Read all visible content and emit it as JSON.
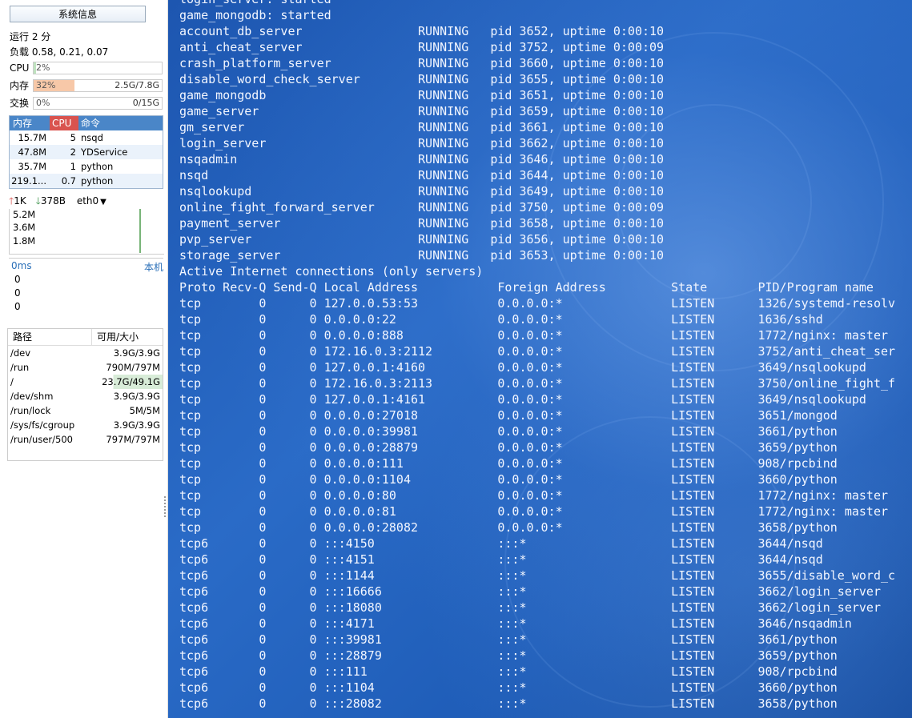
{
  "sidebar": {
    "title": "系统信息",
    "uptime": "运行 2 分",
    "load": "负载 0.58, 0.21, 0.07",
    "meters": {
      "cpu": {
        "label": "CPU",
        "percent": "2%",
        "value": "",
        "fill": 0.02,
        "color": "#bfe3bf"
      },
      "mem": {
        "label": "内存",
        "percent": "32%",
        "value": "2.5G/7.8G",
        "fill": 0.32,
        "color": "#f7c8a8"
      },
      "swap": {
        "label": "交换",
        "percent": "0%",
        "value": "0/15G",
        "fill": 0.0,
        "color": "#cfe0f5"
      }
    },
    "process_table": {
      "headers": {
        "mem": "内存",
        "cpu": "CPU",
        "cmd": "命令"
      },
      "rows": [
        {
          "mem": "15.7M",
          "cpu": "5",
          "cmd": "nsqd"
        },
        {
          "mem": "47.8M",
          "cpu": "2",
          "cmd": "YDService"
        },
        {
          "mem": "35.7M",
          "cpu": "1",
          "cmd": "python"
        },
        {
          "mem": "219.1...",
          "cpu": "0.7",
          "cmd": "python"
        }
      ]
    },
    "network": {
      "up_arrow": "🡑",
      "up": "1K",
      "down_arrow": "🡓",
      "down": "378B",
      "iface": "eth0",
      "dropdown": "▼",
      "ticks": [
        "5.2M",
        "3.6M",
        "1.8M"
      ]
    },
    "ping": {
      "latency": "0ms",
      "host": "本机",
      "values": [
        "0",
        "0",
        "0"
      ]
    },
    "disk": {
      "headers": {
        "path": "路径",
        "size": "可用/大小"
      },
      "rows": [
        {
          "path": "/dev",
          "size": "3.9G/3.9G"
        },
        {
          "path": "/run",
          "size": "790M/797M"
        },
        {
          "path": "/",
          "size": "23.7G/49.1G"
        },
        {
          "path": "/dev/shm",
          "size": "3.9G/3.9G"
        },
        {
          "path": "/run/lock",
          "size": "5M/5M"
        },
        {
          "path": "/sys/fs/cgroup",
          "size": "3.9G/3.9G"
        },
        {
          "path": "/run/user/500",
          "size": "797M/797M"
        }
      ]
    }
  },
  "terminal": {
    "lines": [
      "login_server: started",
      "game_mongodb: started",
      "account_db_server                RUNNING   pid 3652, uptime 0:00:10",
      "anti_cheat_server                RUNNING   pid 3752, uptime 0:00:09",
      "crash_platform_server            RUNNING   pid 3660, uptime 0:00:10",
      "disable_word_check_server        RUNNING   pid 3655, uptime 0:00:10",
      "game_mongodb                     RUNNING   pid 3651, uptime 0:00:10",
      "game_server                      RUNNING   pid 3659, uptime 0:00:10",
      "gm_server                        RUNNING   pid 3661, uptime 0:00:10",
      "login_server                     RUNNING   pid 3662, uptime 0:00:10",
      "nsqadmin                         RUNNING   pid 3646, uptime 0:00:10",
      "nsqd                             RUNNING   pid 3644, uptime 0:00:10",
      "nsqlookupd                       RUNNING   pid 3649, uptime 0:00:10",
      "online_fight_forward_server      RUNNING   pid 3750, uptime 0:00:09",
      "payment_server                   RUNNING   pid 3658, uptime 0:00:10",
      "pvp_server                       RUNNING   pid 3656, uptime 0:00:10",
      "storage_server                   RUNNING   pid 3653, uptime 0:00:10",
      "Active Internet connections (only servers)",
      "Proto Recv-Q Send-Q Local Address           Foreign Address         State       PID/Program name",
      "tcp        0      0 127.0.0.53:53           0.0.0.0:*               LISTEN      1326/systemd-resolv",
      "tcp        0      0 0.0.0.0:22              0.0.0.0:*               LISTEN      1636/sshd",
      "tcp        0      0 0.0.0.0:888             0.0.0.0:*               LISTEN      1772/nginx: master",
      "tcp        0      0 172.16.0.3:2112         0.0.0.0:*               LISTEN      3752/anti_cheat_ser",
      "tcp        0      0 127.0.0.1:4160          0.0.0.0:*               LISTEN      3649/nsqlookupd",
      "tcp        0      0 172.16.0.3:2113         0.0.0.0:*               LISTEN      3750/online_fight_f",
      "tcp        0      0 127.0.0.1:4161          0.0.0.0:*               LISTEN      3649/nsqlookupd",
      "tcp        0      0 0.0.0.0:27018           0.0.0.0:*               LISTEN      3651/mongod",
      "tcp        0      0 0.0.0.0:39981           0.0.0.0:*               LISTEN      3661/python",
      "tcp        0      0 0.0.0.0:28879           0.0.0.0:*               LISTEN      3659/python",
      "tcp        0      0 0.0.0.0:111             0.0.0.0:*               LISTEN      908/rpcbind",
      "tcp        0      0 0.0.0.0:1104            0.0.0.0:*               LISTEN      3660/python",
      "tcp        0      0 0.0.0.0:80              0.0.0.0:*               LISTEN      1772/nginx: master",
      "tcp        0      0 0.0.0.0:81              0.0.0.0:*               LISTEN      1772/nginx: master",
      "tcp        0      0 0.0.0.0:28082           0.0.0.0:*               LISTEN      3658/python",
      "tcp6       0      0 :::4150                 :::*                    LISTEN      3644/nsqd",
      "tcp6       0      0 :::4151                 :::*                    LISTEN      3644/nsqd",
      "tcp6       0      0 :::1144                 :::*                    LISTEN      3655/disable_word_c",
      "tcp6       0      0 :::16666                :::*                    LISTEN      3662/login_server",
      "tcp6       0      0 :::18080                :::*                    LISTEN      3662/login_server",
      "tcp6       0      0 :::4171                 :::*                    LISTEN      3646/nsqadmin",
      "tcp6       0      0 :::39981                :::*                    LISTEN      3661/python",
      "tcp6       0      0 :::28879                :::*                    LISTEN      3659/python",
      "tcp6       0      0 :::111                  :::*                    LISTEN      908/rpcbind",
      "tcp6       0      0 :::1104                 :::*                    LISTEN      3660/python",
      "tcp6       0      0 :::28082                :::*                    LISTEN      3658/python"
    ]
  }
}
